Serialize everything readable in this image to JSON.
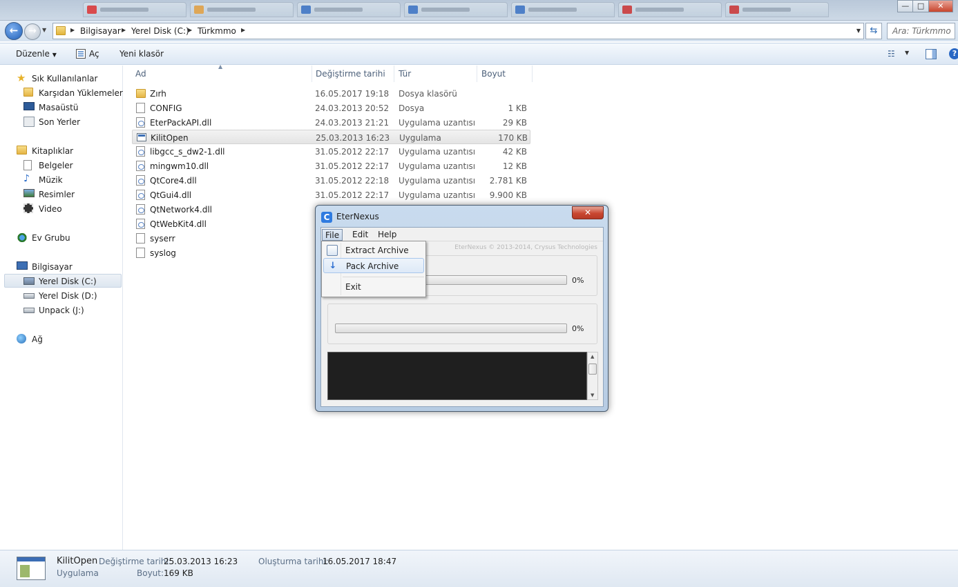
{
  "window": {
    "minimize_glyph": "—",
    "maximize_glyph": "□",
    "close_glyph": "✕"
  },
  "address": {
    "crumbs": [
      "Bilgisayar",
      "Yerel Disk (C:)",
      "Türkmmo"
    ],
    "search_placeholder": "Ara: Türkmmo"
  },
  "toolbar": {
    "organize": "Düzenle",
    "open": "Aç",
    "new_folder": "Yeni klasör"
  },
  "sidebar": {
    "favorites": {
      "label": "Sık Kullanılanlar",
      "items": [
        "Karşıdan Yüklemeler",
        "Masaüstü",
        "Son Yerler"
      ]
    },
    "libraries": {
      "label": "Kitaplıklar",
      "items": [
        "Belgeler",
        "Müzik",
        "Resimler",
        "Video"
      ]
    },
    "homegroup": "Ev Grubu",
    "computer": {
      "label": "Bilgisayar",
      "items": [
        "Yerel Disk (C:)",
        "Yerel Disk (D:)",
        "Unpack (J:)"
      ]
    },
    "network": "Ağ"
  },
  "columns": {
    "name": "Ad",
    "modified": "Değiştirme tarihi",
    "type": "Tür",
    "size": "Boyut"
  },
  "files": [
    {
      "name": "Zırh",
      "date": "16.05.2017 19:18",
      "type": "Dosya klasörü",
      "size": "",
      "icon": "folder-icon"
    },
    {
      "name": "CONFIG",
      "date": "24.03.2013 20:52",
      "type": "Dosya",
      "size": "1 KB",
      "icon": "file-icon"
    },
    {
      "name": "EterPackAPI.dll",
      "date": "24.03.2013 21:21",
      "type": "Uygulama uzantısı",
      "size": "29 KB",
      "icon": "dll-icon"
    },
    {
      "name": "KilitOpen",
      "date": "25.03.2013 16:23",
      "type": "Uygulama",
      "size": "170 KB",
      "icon": "app-icon"
    },
    {
      "name": "libgcc_s_dw2-1.dll",
      "date": "31.05.2012 22:17",
      "type": "Uygulama uzantısı",
      "size": "42 KB",
      "icon": "dll-icon"
    },
    {
      "name": "mingwm10.dll",
      "date": "31.05.2012 22:17",
      "type": "Uygulama uzantısı",
      "size": "12 KB",
      "icon": "dll-icon"
    },
    {
      "name": "QtCore4.dll",
      "date": "31.05.2012 22:18",
      "type": "Uygulama uzantısı",
      "size": "2.781 KB",
      "icon": "dll-icon"
    },
    {
      "name": "QtGui4.dll",
      "date": "31.05.2012 22:17",
      "type": "Uygulama uzantısı",
      "size": "9.900 KB",
      "icon": "dll-icon"
    },
    {
      "name": "QtNetwork4.dll",
      "date": "",
      "type": "",
      "size": "",
      "icon": "dll-icon"
    },
    {
      "name": "QtWebKit4.dll",
      "date": "",
      "type": "",
      "size": "",
      "icon": "dll-icon"
    },
    {
      "name": "syserr",
      "date": "",
      "type": "",
      "size": "",
      "icon": "file-icon"
    },
    {
      "name": "syslog",
      "date": "",
      "type": "",
      "size": "",
      "icon": "file-icon"
    }
  ],
  "details": {
    "name": "KilitOpen",
    "kind": "Uygulama",
    "modified_label": "Değiştirme tarihi:",
    "modified_value": "25.03.2013 16:23",
    "size_label": "Boyut:",
    "size_value": "169 KB",
    "created_label": "Oluşturma tarihi:",
    "created_value": "16.05.2017 18:47"
  },
  "dialog": {
    "title": "EterNexus",
    "menu": [
      "File",
      "Edit",
      "Help"
    ],
    "watermark": "EterNexus © 2013-2014, Crysus Technologies",
    "progress1": "0%",
    "progress2": "0%",
    "file_menu": {
      "extract": "Extract Archive",
      "pack": "Pack Archive",
      "exit": "Exit"
    }
  }
}
